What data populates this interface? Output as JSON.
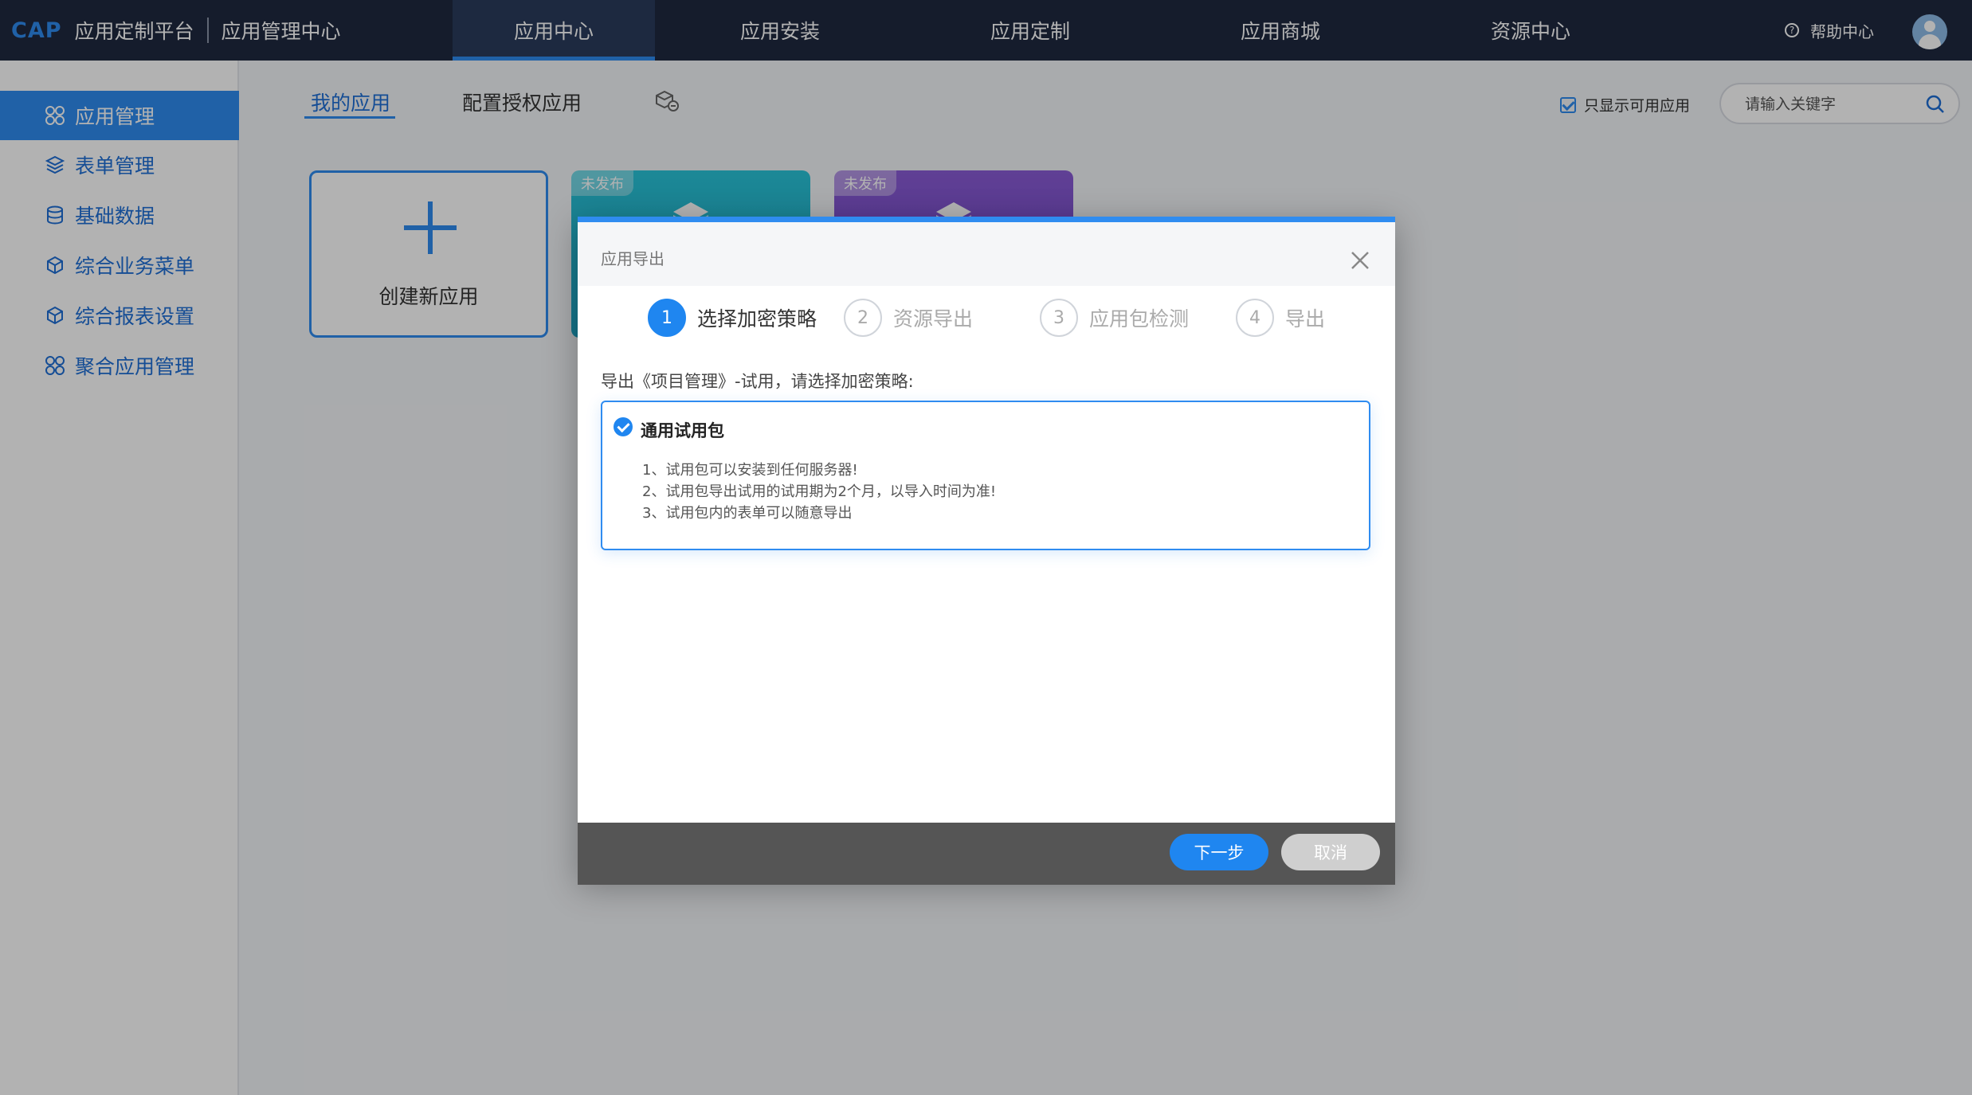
{
  "topbar": {
    "brand_short": "CAP",
    "brand_name": "应用定制平台",
    "center_name": "应用管理中心",
    "nav": [
      {
        "label": "应用中心",
        "active": true
      },
      {
        "label": "应用安装"
      },
      {
        "label": "应用定制"
      },
      {
        "label": "应用商城"
      },
      {
        "label": "资源中心"
      }
    ],
    "help_label": "帮助中心",
    "help_icon": "question-circle-icon",
    "avatar_icon": "user-avatar-icon"
  },
  "sidebar": {
    "items": [
      {
        "label": "应用管理",
        "icon": "app-grid-icon",
        "active": true
      },
      {
        "label": "表单管理",
        "icon": "layers-icon"
      },
      {
        "label": "基础数据",
        "icon": "database-icon"
      },
      {
        "label": "综合业务菜单",
        "icon": "cube-icon"
      },
      {
        "label": "综合报表设置",
        "icon": "cube-icon"
      },
      {
        "label": "聚合应用管理",
        "icon": "app-grid-icon"
      }
    ]
  },
  "main": {
    "tabs": [
      {
        "label": "我的应用",
        "active": true
      },
      {
        "label": "配置授权应用"
      }
    ],
    "filter_label": "只显示可用应用",
    "search_placeholder": "请输入关键字",
    "create_label": "创建新应用",
    "app_cards": [
      {
        "badge": "未发布",
        "color": "#1ea4c4"
      },
      {
        "badge": "未发布",
        "color": "#6b3fc2"
      }
    ]
  },
  "dialog": {
    "title": "应用导出",
    "steps": [
      {
        "num": "1",
        "label": "选择加密策略",
        "active": true
      },
      {
        "num": "2",
        "label": "资源导出"
      },
      {
        "num": "3",
        "label": "应用包检测"
      },
      {
        "num": "4",
        "label": "导出"
      }
    ],
    "prompt": "导出《项目管理》-试用，请选择加密策略:",
    "option": {
      "title": "通用试用包",
      "lines": [
        "1、试用包可以安装到任何服务器!",
        "2、试用包导出试用的试用期为2个月，以导入时间为准!",
        "3、试用包内的表单可以随意导出"
      ]
    },
    "next_label": "下一步",
    "cancel_label": "取消"
  },
  "colors": {
    "accent": "#2f8cf0",
    "topbar": "#1f2940"
  }
}
